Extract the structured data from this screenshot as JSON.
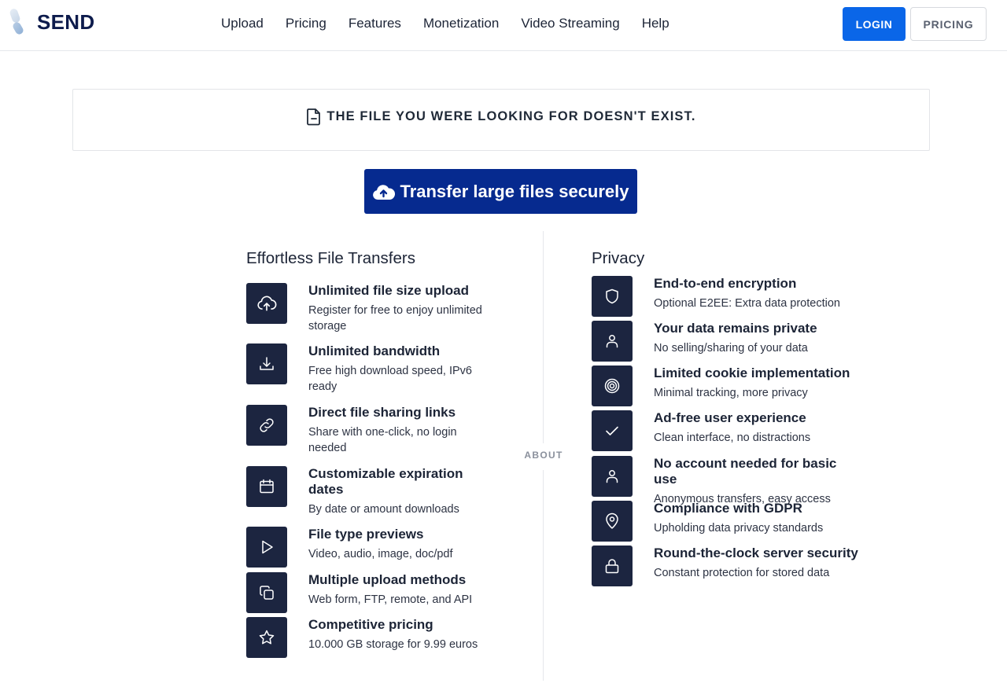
{
  "header": {
    "logo_text": "SEND",
    "nav": [
      "Upload",
      "Pricing",
      "Features",
      "Monetization",
      "Video Streaming",
      "Help"
    ],
    "login_label": "LOGIN",
    "pricing_label": "PRICING"
  },
  "notice": {
    "icon": "file-icon",
    "text": "THE FILE YOU WERE LOOKING FOR DOESN'T EXIST."
  },
  "cta": {
    "icon": "cloud-upload-icon",
    "label": "Transfer large files securely"
  },
  "about_label": "ABOUT",
  "left": {
    "title": "Effortless File Transfers",
    "items": [
      {
        "icon": "cloud-upload-icon",
        "title": "Unlimited file size upload",
        "desc": "Register for free to enjoy unlimited storage"
      },
      {
        "icon": "download-icon",
        "title": "Unlimited bandwidth",
        "desc": "Free high download speed, IPv6 ready"
      },
      {
        "icon": "link-icon",
        "title": "Direct file sharing links",
        "desc": "Share with one-click, no login needed"
      },
      {
        "icon": "calendar-icon",
        "title": "Customizable expiration dates",
        "desc": "By date or amount downloads"
      },
      {
        "icon": "play-icon",
        "title": "File type previews",
        "desc": "Video, audio, image, doc/pdf"
      },
      {
        "icon": "copy-icon",
        "title": "Multiple upload methods",
        "desc": "Web form, FTP, remote, and API"
      },
      {
        "icon": "star-icon",
        "title": "Competitive pricing",
        "desc": "10.000 GB storage for 9.99 euros"
      }
    ]
  },
  "right": {
    "title": "Privacy",
    "items": [
      {
        "icon": "shield-icon",
        "title": "End-to-end encryption",
        "desc": "Optional E2EE: Extra data protection"
      },
      {
        "icon": "user-icon",
        "title": "Your data remains private",
        "desc": "No selling/sharing of your data"
      },
      {
        "icon": "target-icon",
        "title": "Limited cookie implementation",
        "desc": "Minimal tracking, more privacy"
      },
      {
        "icon": "check-icon",
        "title": "Ad-free user experience",
        "desc": "Clean interface, no distractions"
      },
      {
        "icon": "user-icon",
        "title": "No account needed for basic use",
        "desc": "Anonymous transfers, easy access"
      },
      {
        "icon": "map-pin-icon",
        "title": "Compliance with GDPR",
        "desc": "Upholding data privacy standards"
      },
      {
        "icon": "lock-icon",
        "title": "Round-the-clock server security",
        "desc": "Constant protection for stored data"
      }
    ]
  }
}
